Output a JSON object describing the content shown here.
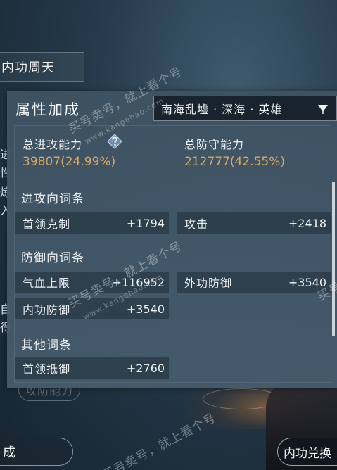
{
  "side_tab": {
    "label": "内功周天"
  },
  "left_fragments": [
    "进",
    "性",
    "炼",
    "入",
    "自",
    "得"
  ],
  "panel": {
    "title": "属性加成",
    "region_select": {
      "value": "南海乱墟 · 深海 · 英雄"
    },
    "totals": {
      "attack": {
        "label": "总进攻能力",
        "value": "39807(24.99%)"
      },
      "defense": {
        "label": "总防守能力",
        "value": "212777(42.55%)"
      }
    },
    "sections": {
      "attack": {
        "title": "进攻向词条",
        "rows": [
          {
            "name": "首领克制",
            "value": "+1794"
          },
          {
            "name": "攻击",
            "value": "+2418"
          }
        ]
      },
      "defense": {
        "title": "防御向词条",
        "rows": [
          {
            "name": "气血上限",
            "value": "+116952"
          },
          {
            "name": "外功防御",
            "value": "+3540"
          },
          {
            "name": "内功防御",
            "value": "+3540"
          }
        ]
      },
      "other": {
        "title": "其他词条",
        "rows": [
          {
            "name": "首领抵御",
            "value": "+2760"
          }
        ]
      }
    }
  },
  "background_button": {
    "label": "攻防能力"
  },
  "bottom_left": {
    "label": "成"
  },
  "bottom_right": {
    "label": "内功兑换"
  },
  "watermark": {
    "text": "买号卖号，就上看个号",
    "domain": "www.kangehao.com",
    "badge": "看个号",
    "edge": "买号"
  },
  "colors": {
    "value_gold": "#d9a865",
    "panel_bg": "#3e5262"
  },
  "icons": {
    "help": "help-diamond-icon",
    "dropdown": "triangle-down-icon"
  }
}
